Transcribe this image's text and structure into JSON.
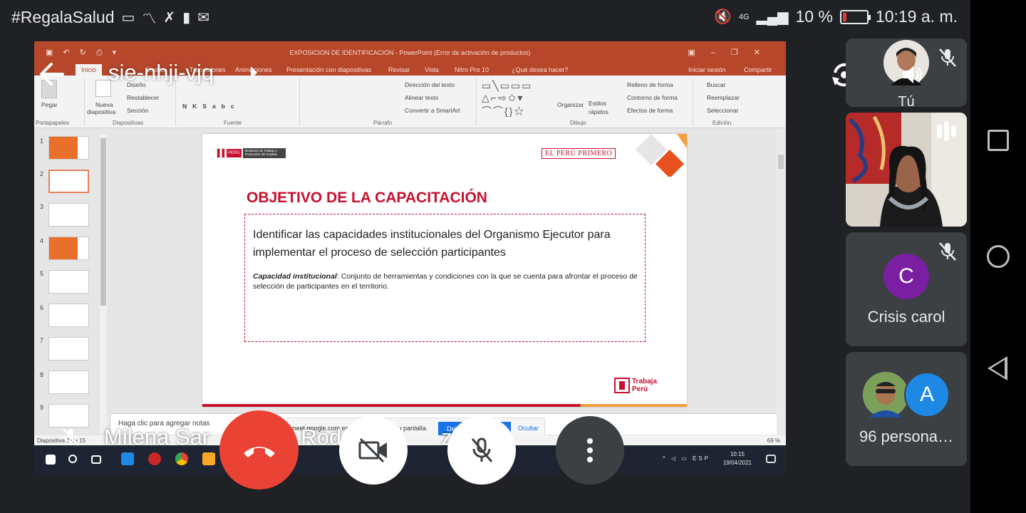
{
  "status_bar": {
    "left_text": "#RegalaSalud",
    "battery": "10 %",
    "time": "10:19 a. m.",
    "network": "4G"
  },
  "meeting": {
    "code": "sie-nhji-vjq",
    "presenter_name": "Milena Sar",
    "presenter_name_tail": "Rod",
    "presenter_name_end": "z"
  },
  "participants": [
    {
      "name": "Tú"
    },
    {
      "name": ""
    },
    {
      "name": "Crisis carol",
      "initial": "C",
      "color": "#7b1fa2"
    },
    {
      "name": "96 persona…",
      "initial": "A",
      "color": "#1e88e5"
    }
  ],
  "powerpoint": {
    "window_title": "EXPOSICION  DE IDENTIFICACION - PowerPoint (Error de activación de productos)",
    "tabs": [
      "Inicio",
      "Diseño",
      "Transiciones",
      "Animaciones",
      "Presentación con diapositivas",
      "Revisar",
      "Vista",
      "Nitro Pro 10",
      "¿Qué desea hacer?",
      "Iniciar sesión",
      "Compartir"
    ],
    "ribbon": {
      "pegar": "Pegar",
      "portapapeles": "Portapapeles",
      "nueva": "Nueva",
      "diapositiva": "diapositiva",
      "diseno": "Diseño",
      "restablecer": "Restablecer",
      "seccion": "Sección",
      "diapositivas": "Diapositivas",
      "fuente": "Fuente",
      "direccion": "Dirección del texto",
      "alinear": "Alinear texto",
      "convertir": "Convertir a SmartArt",
      "parrafo": "Párrafo",
      "organizar": "Organizar",
      "estilos": "Estilos",
      "rapidos": "rápidos",
      "relleno": "Relleno de forma",
      "contorno": "Contorno de forma",
      "efectos": "Efectos de forma",
      "dibujo": "Dibujo",
      "buscar": "Buscar",
      "reemplazar": "Reemplazar",
      "seleccionar": "Seleccionar",
      "edicion": "Edición"
    },
    "slide_numbers": [
      "1",
      "2",
      "3",
      "4",
      "5",
      "6",
      "7",
      "8",
      "9"
    ],
    "slide": {
      "ministry": "Ministerio de Trabajo y Promoción del Empleo",
      "peru": "PERÚ",
      "el_peru_primero": "EL PERÚ PRIMERO",
      "title": "OBJETIVO DE LA CAPACITACIÓN",
      "main_text": "Identificar las capacidades institucionales del  Organismo Ejecutor para implementar el proceso de selección participantes",
      "sub_label": "Capacidad institucional",
      "sub_text": ": Conjunto de herramientas y condiciones con la que se cuenta para afrontar el proceso de selección de participantes en el territorio.",
      "trabaja": "Trabaja",
      "peru_logo": "Perú"
    },
    "notes_placeholder": "Haga clic para agregar notas",
    "share_message": "meet.google.com está compartiendo tu pantalla.",
    "share_stop": "Dejar de compartir",
    "share_hide": "Ocultar",
    "status_left": "Diapositiva 2 de 15",
    "zoom": "69 %",
    "taskbar_time": "10:15",
    "taskbar_date": "19/04/2021",
    "taskbar_lang": "ESP"
  }
}
